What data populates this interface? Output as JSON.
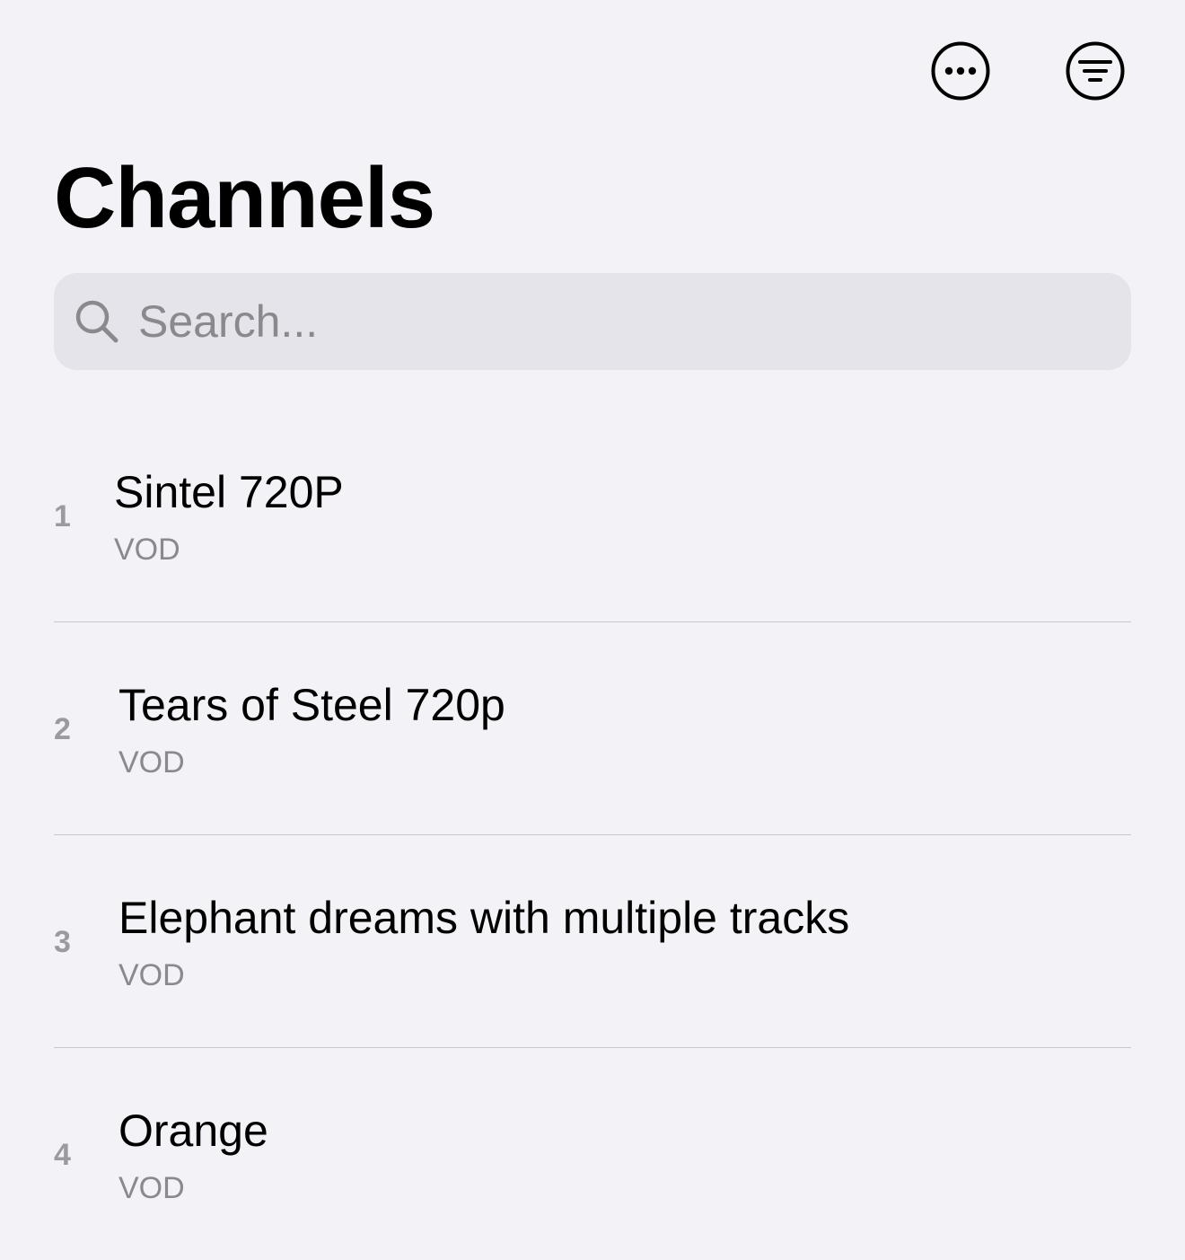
{
  "toolbar": {
    "more_icon": "ellipsis-circle-icon",
    "filter_icon": "line-3-horizontal-decrease-circle-icon"
  },
  "page": {
    "title": "Channels"
  },
  "search": {
    "placeholder": "Search...",
    "value": "",
    "icon": "magnifying-glass-icon"
  },
  "channels": [
    {
      "number": "1",
      "name": "Sintel 720P",
      "type": "VOD"
    },
    {
      "number": "2",
      "name": "Tears of Steel 720p",
      "type": "VOD"
    },
    {
      "number": "3",
      "name": "Elephant dreams with multiple tracks",
      "type": "VOD"
    },
    {
      "number": "4",
      "name": "Orange",
      "type": "VOD"
    }
  ],
  "colors": {
    "background": "#f2f2f7",
    "search_field": "#e4e4ea",
    "secondary_text": "#8a8a8e",
    "separator": "#c8c8cc"
  }
}
